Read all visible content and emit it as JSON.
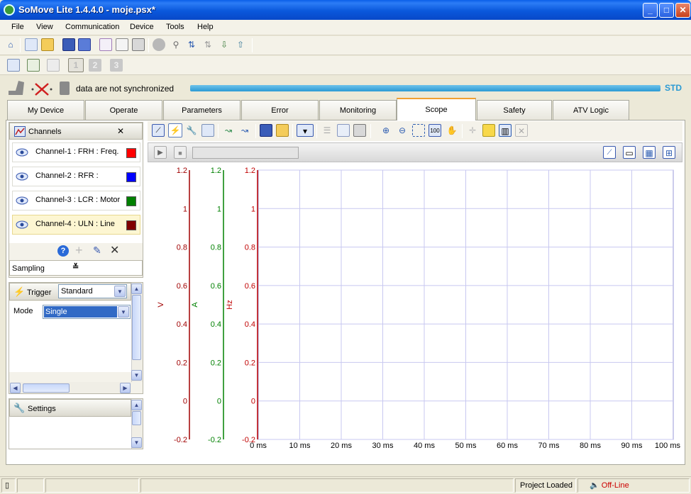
{
  "window": {
    "title": "SoMove Lite 1.4.4.0 - moje.psx*"
  },
  "menu": [
    "File",
    "View",
    "Communication",
    "Device",
    "Tools",
    "Help"
  ],
  "sync": {
    "message": "data are not synchronized",
    "badge": "STD"
  },
  "tabs": [
    "My Device",
    "Operate",
    "Parameters",
    "Error",
    "Monitoring",
    "Scope",
    "Safety",
    "ATV Logic"
  ],
  "active_tab": "Scope",
  "channels": {
    "title": "Channels",
    "items": [
      {
        "label": "Channel-1 : FRH : Freq.",
        "color": "#ff0000"
      },
      {
        "label": "Channel-2 : RFR :",
        "color": "#0000ff"
      },
      {
        "label": "Channel-3 : LCR : Motor",
        "color": "#008000"
      },
      {
        "label": "Channel-4 : ULN : Line",
        "color": "#800000"
      }
    ],
    "sampling_label": "Sampling"
  },
  "trigger": {
    "title": "Trigger",
    "type_value": "Standard",
    "mode_label": "Mode",
    "mode_value": "Single"
  },
  "settings": {
    "title": "Settings"
  },
  "chart_data": {
    "type": "line",
    "x": {
      "ticks": [
        "0 ms",
        "10 ms",
        "20 ms",
        "30 ms",
        "40 ms",
        "50 ms",
        "60 ms",
        "70 ms",
        "80 ms",
        "90 ms",
        "100 ms"
      ],
      "range": [
        0,
        100
      ]
    },
    "y_axes": [
      {
        "label": "V",
        "color": "#a00000",
        "ticks": [
          "1.2",
          "1",
          "0.8",
          "0.6",
          "0.4",
          "0.2",
          "0",
          "-0.2"
        ]
      },
      {
        "label": "A",
        "color": "#008000",
        "ticks": [
          "1.2",
          "1",
          "0.8",
          "0.6",
          "0.4",
          "0.2",
          "0",
          "-0.2"
        ]
      },
      {
        "label": "Hz",
        "color": "#c00000",
        "ticks": [
          "1.2",
          "1",
          "0.8",
          "0.6",
          "0.4",
          "0.2",
          "0",
          "-0.2"
        ]
      }
    ],
    "y_range": [
      -0.2,
      1.2
    ],
    "grid": true,
    "series": []
  },
  "status": {
    "project": "Project Loaded",
    "connection": "Off-Line",
    "connection_color": "#cc0000"
  }
}
